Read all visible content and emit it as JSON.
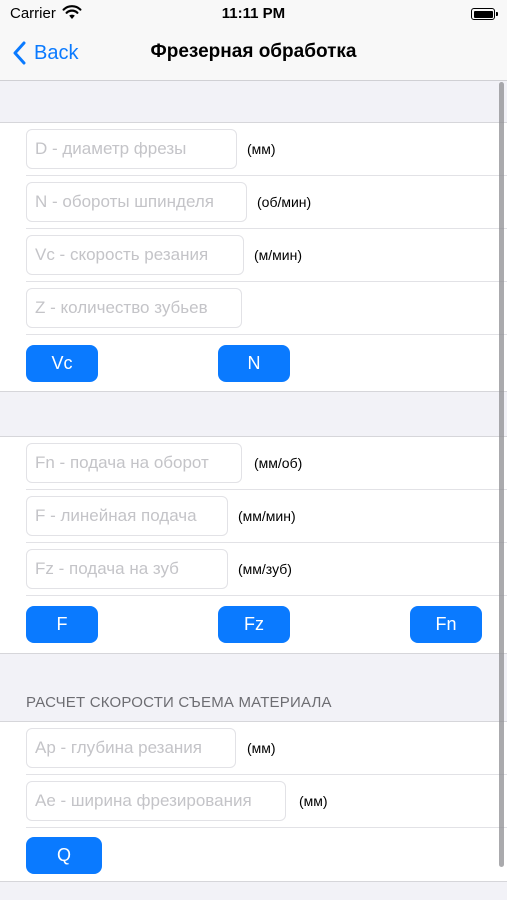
{
  "status_bar": {
    "carrier": "Carrier",
    "time": "11:11 PM"
  },
  "nav": {
    "back_label": "Back",
    "title": "Фрезерная обработка"
  },
  "section1": {
    "fields": [
      {
        "placeholder": "D - диаметр фрезы",
        "value": "",
        "unit": "(мм)"
      },
      {
        "placeholder": "N - обороты шпинделя",
        "value": "",
        "unit": "(об/мин)"
      },
      {
        "placeholder": "Vc - скорость резания",
        "value": "",
        "unit": "(м/мин)"
      },
      {
        "placeholder": "Z - количество зубьев",
        "value": "",
        "unit": ""
      }
    ],
    "buttons": [
      "Vc",
      "N"
    ]
  },
  "section2": {
    "fields": [
      {
        "placeholder": "Fn - подача на оборот",
        "value": "",
        "unit": "(мм/об)"
      },
      {
        "placeholder": "F - линейная подача",
        "value": "",
        "unit": "(мм/мин)"
      },
      {
        "placeholder": "Fz - подача на зуб",
        "value": "",
        "unit": "(мм/зуб)"
      }
    ],
    "buttons": [
      "F",
      "Fz",
      "Fn"
    ]
  },
  "section3": {
    "header": "РАСЧЕТ СКОРОСТИ СЪЕМА МАТЕРИАЛА",
    "fields": [
      {
        "placeholder": "Ap - глубина резания",
        "value": "",
        "unit": "(мм)"
      },
      {
        "placeholder": "Ae - ширина фрезирования",
        "value": "",
        "unit": "(мм)"
      }
    ],
    "buttons": [
      "Q"
    ]
  },
  "colors": {
    "accent": "#0a7aff",
    "background": "#f2f2f7",
    "placeholder": "#c4c4c8"
  },
  "icons": [
    "wifi-icon",
    "battery-icon",
    "chevron-left-icon"
  ]
}
